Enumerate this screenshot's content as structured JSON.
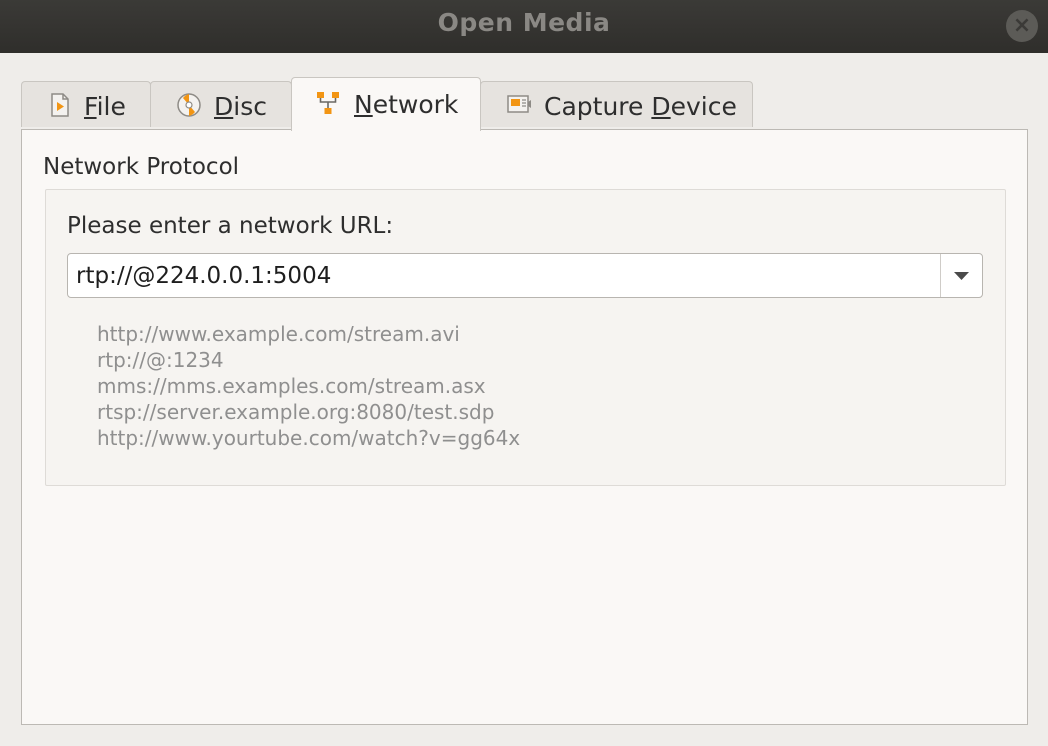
{
  "window": {
    "title": "Open Media",
    "close_label": "×"
  },
  "tabs": [
    {
      "id": "file",
      "prefix": "",
      "mnemonic": "F",
      "rest": "ile",
      "icon": "file-play-icon",
      "active": false
    },
    {
      "id": "disc",
      "prefix": "",
      "mnemonic": "D",
      "rest": "isc",
      "icon": "disc-icon",
      "active": false
    },
    {
      "id": "network",
      "prefix": "",
      "mnemonic": "N",
      "rest": "etwork",
      "icon": "network-icon",
      "active": true
    },
    {
      "id": "capture",
      "prefix": "Capture ",
      "mnemonic": "D",
      "rest": "evice",
      "icon": "capture-device-icon",
      "active": false
    }
  ],
  "network": {
    "group_title": "Network Protocol",
    "url_label": "Please enter a network URL:",
    "url_value": "rtp://@224.0.0.1:5004",
    "dropdown_icon": "chevron-down-icon",
    "examples": [
      "http://www.example.com/stream.avi",
      "rtp://@:1234",
      "mms://mms.examples.com/stream.asx",
      "rtsp://server.example.org:8080/test.sdp",
      "http://www.yourtube.com/watch?v=gg64x"
    ]
  },
  "colors": {
    "accent_orange": "#f29513",
    "titlebar": "#2f2e2b",
    "panel_bg": "#faf8f6"
  }
}
